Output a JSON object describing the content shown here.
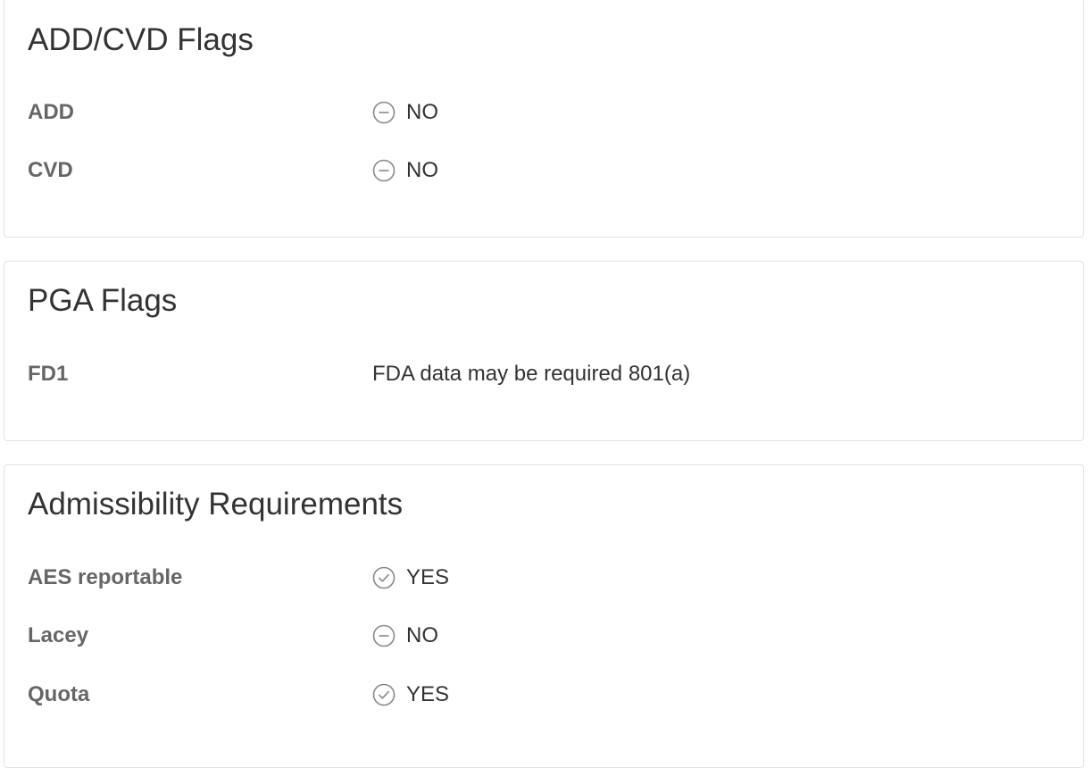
{
  "sections": {
    "adcvd": {
      "title": "ADD/CVD Flags",
      "rows": [
        {
          "label": "ADD",
          "value": "NO",
          "icon": "minus-circle-icon"
        },
        {
          "label": "CVD",
          "value": "NO",
          "icon": "minus-circle-icon"
        }
      ]
    },
    "pga": {
      "title": "PGA Flags",
      "rows": [
        {
          "label": "FD1",
          "value": "FDA data may be required 801(a)"
        }
      ]
    },
    "admissibility": {
      "title": "Admissibility Requirements",
      "rows": [
        {
          "label": "AES reportable",
          "value": "YES",
          "icon": "check-circle-icon"
        },
        {
          "label": "Lacey",
          "value": "NO",
          "icon": "minus-circle-icon"
        },
        {
          "label": "Quota",
          "value": "YES",
          "icon": "check-circle-icon"
        }
      ]
    }
  },
  "colors": {
    "border": "#e2e2e2",
    "label": "#666666",
    "text": "#333333",
    "icon": "#888888"
  }
}
